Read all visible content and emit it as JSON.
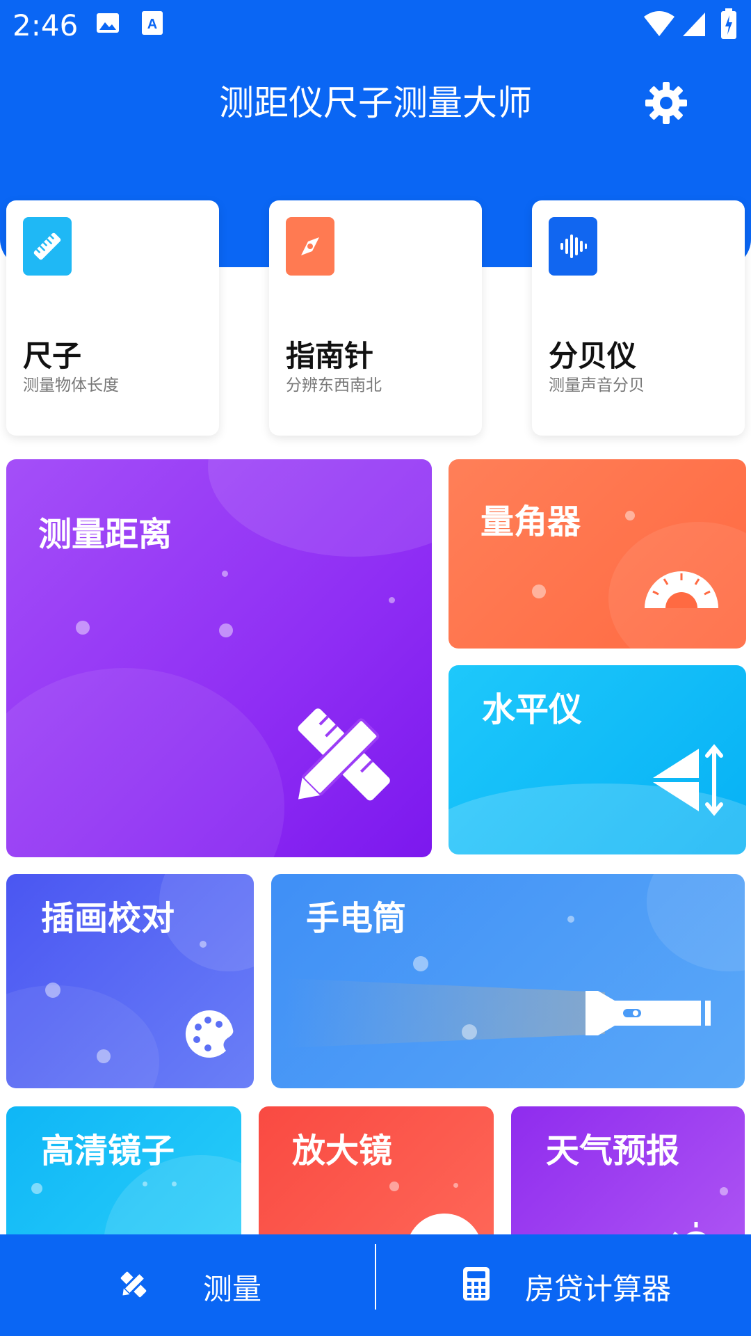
{
  "status_bar": {
    "time": "2:46"
  },
  "header": {
    "title": "测距仪尺子测量大师"
  },
  "top_cards": [
    {
      "title": "尺子",
      "subtitle": "测量物体长度",
      "color": "#1fb8f5",
      "icon": "ruler-icon"
    },
    {
      "title": "指南针",
      "subtitle": "分辨东西南北",
      "color": "#ff7a52",
      "icon": "compass-icon"
    },
    {
      "title": "分贝仪",
      "subtitle": "测量声音分贝",
      "color": "#1166f0",
      "icon": "sound-wave-icon"
    }
  ],
  "tiles": {
    "measure_distance": {
      "label": "测量距离",
      "color": "#9b3cf6"
    },
    "protractor": {
      "label": "量角器",
      "color": "#ff7048"
    },
    "level": {
      "label": "水平仪",
      "color": "#12bbf8"
    },
    "illustration": {
      "label": "插画校对",
      "color": "#5b6ff5"
    },
    "flashlight": {
      "label": "手电筒",
      "color": "#4a9bf7"
    },
    "mirror": {
      "label": "高清镜子",
      "color": "#18c2f7"
    },
    "magnifier": {
      "label": "放大镜",
      "color": "#fb5448"
    },
    "weather": {
      "label": "天气预报",
      "color": "#9f44f0"
    }
  },
  "bottom_nav": {
    "items": [
      {
        "label": "测量",
        "icon": "ruler-pencil-icon"
      },
      {
        "label": "房贷计算器",
        "icon": "calculator-icon"
      }
    ]
  },
  "colors": {
    "primary": "#0a66f4"
  }
}
